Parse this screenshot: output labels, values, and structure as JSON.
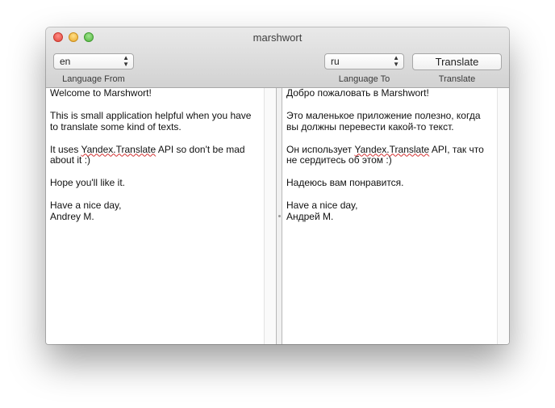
{
  "window": {
    "title": "marshwort"
  },
  "controls": {
    "from_value": "en",
    "from_caption": "Language From",
    "to_value": "ru",
    "to_caption": "Language To",
    "translate_label": "Translate",
    "translate_caption": "Translate"
  },
  "source": {
    "lines": [
      "Welcome to Marshwort!",
      "",
      "This is small application helpful when you have",
      "to translate some kind of texts.",
      "",
      [
        "It uses ",
        "Yandex.Translate",
        " API so don't be mad"
      ],
      "about it :)",
      "",
      "Hope you'll like it.",
      "",
      "Have a nice day,",
      "Andrey M."
    ]
  },
  "target": {
    "lines": [
      "Добро пожаловать в Marshwort!",
      "",
      "Это маленькое приложение полезно, когда",
      "вы должны перевести какой-то текст.",
      "",
      [
        "Он использует ",
        "Yandex.Translate",
        " API, так что"
      ],
      "не сердитесь об этом :)",
      "",
      "Надеюсь вам понравится.",
      "",
      "Have a nice day,",
      "Андрей М."
    ]
  },
  "colors": {
    "close": "#e0443a",
    "minimize": "#e9a82a",
    "zoom": "#53b43f",
    "spelling_underline": "#d43030"
  }
}
